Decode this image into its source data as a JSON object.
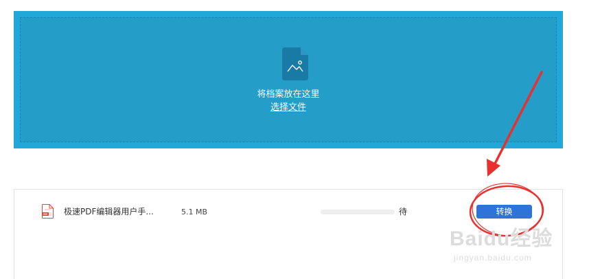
{
  "upload": {
    "drop_text": "将档案放在这里",
    "choose_file_label": "选择文件",
    "colors": {
      "outer": "#21a8d8",
      "inner": "#249dc9",
      "icon": "#1a7aa6"
    }
  },
  "file_list": [
    {
      "file_icon": "pdf-file-icon",
      "name": "极速PDF编辑器用户手...",
      "size": "5.1 MB",
      "progress": 0,
      "status": "待",
      "action_label": "转换"
    }
  ],
  "annotation": {
    "color": "#e8312e",
    "arrow": "red-arrow",
    "highlight": "red-ellipse-around-convert-button"
  },
  "watermark": {
    "logo": "Baidu经验",
    "url": "jingyan.baidu.com"
  }
}
